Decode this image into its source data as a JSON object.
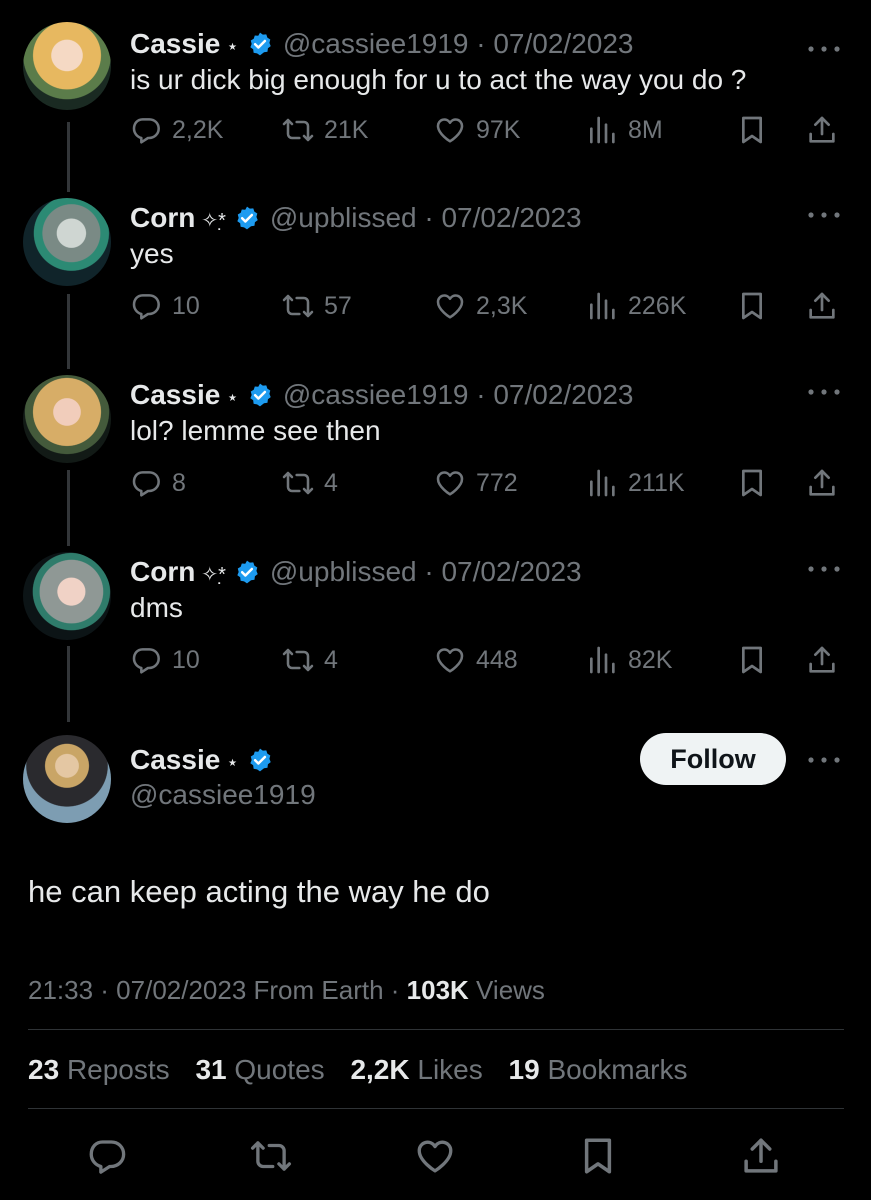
{
  "tweets": [
    {
      "name": "Cassie",
      "deco": "⋆",
      "handle": "@cassiee1919 · 07/02/2023",
      "text": "is ur dick big enough for u to act the way you do ?",
      "replies": "2,2K",
      "reposts": "21K",
      "likes": "97K",
      "views": "8M"
    },
    {
      "name": "Corn",
      "deco": "✧*̣",
      "handle": "@upblissed · 07/02/2023",
      "text": "yes",
      "replies": "10",
      "reposts": "57",
      "likes": "2,3K",
      "views": "226K"
    },
    {
      "name": "Cassie",
      "deco": "⋆",
      "handle": "@cassiee1919 · 07/02/2023",
      "text": "lol? lemme see then",
      "replies": "8",
      "reposts": "4",
      "likes": "772",
      "views": "211K"
    },
    {
      "name": "Corn",
      "deco": "✧*̣",
      "handle": "@upblissed · 07/02/2023",
      "text": "dms",
      "replies": "10",
      "reposts": "4",
      "likes": "448",
      "views": "82K"
    }
  ],
  "main": {
    "name": "Cassie",
    "deco": "⋆",
    "handle": "@cassiee1919",
    "follow_label": "Follow",
    "text": "he can keep acting the way he do",
    "meta_prefix": "21:33 · 07/02/2023 From Earth · ",
    "views_count": "103K",
    "views_label": "Views",
    "reposts_count": "23",
    "reposts_label": "Reposts",
    "quotes_count": "31",
    "quotes_label": "Quotes",
    "likes_count": "2,2K",
    "likes_label": "Likes",
    "bookmarks_count": "19",
    "bookmarks_label": "Bookmarks"
  },
  "colors": {
    "verified": "#1d9bf0",
    "muted": "#71767b",
    "text": "#e7e9ea",
    "background": "#000000"
  },
  "icons": [
    "reply-icon",
    "repost-icon",
    "like-icon",
    "views-icon",
    "bookmark-icon",
    "share-icon",
    "more-icon",
    "verified-badge-icon"
  ]
}
